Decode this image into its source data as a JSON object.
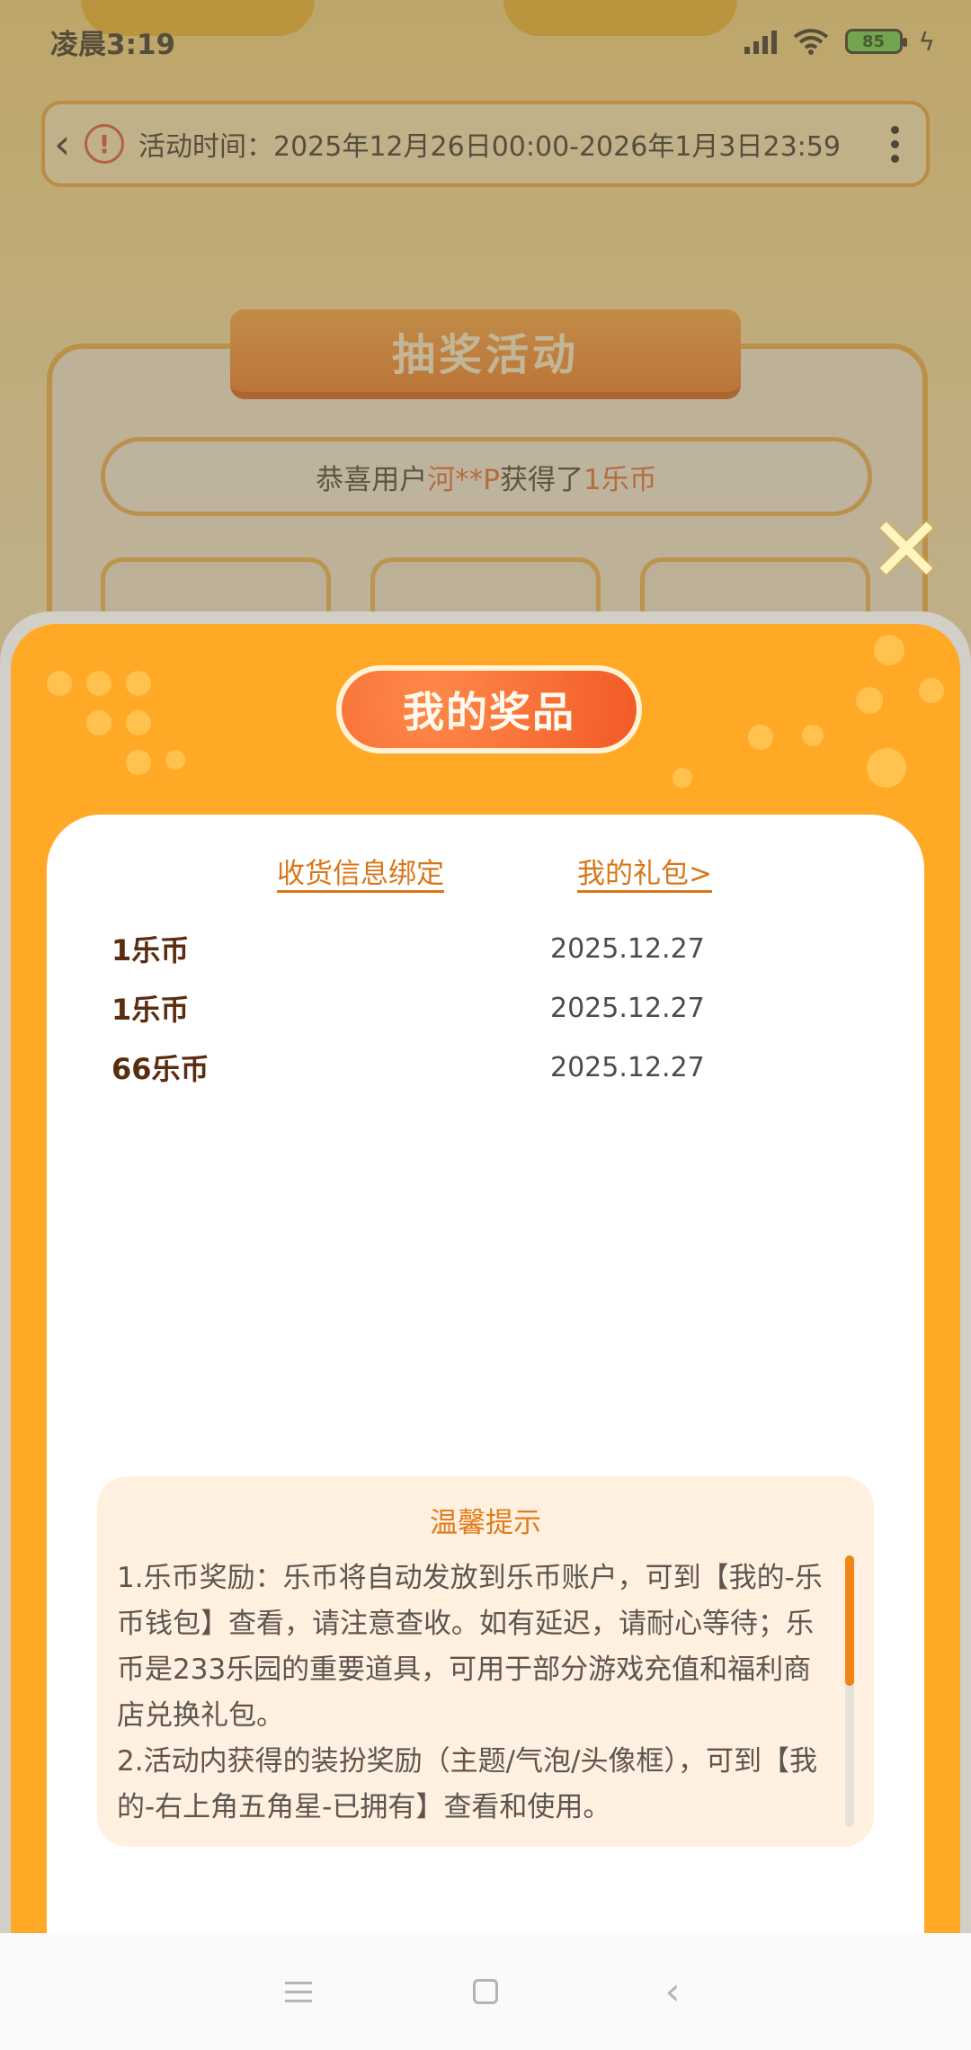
{
  "status_bar": {
    "time": "凌晨3:19",
    "battery": "85"
  },
  "activity": {
    "time_text": "活动时间：2025年12月26日00:00-2026年1月3日23:59"
  },
  "lottery": {
    "title": "抽奖活动",
    "ticker_prefix": "恭喜用户",
    "ticker_user": "河**P",
    "ticker_middle": "获得了",
    "ticker_prize": "1乐币"
  },
  "close_symbol": "✕",
  "prizes_sheet": {
    "title": "我的奖品",
    "link_address": "收货信息绑定",
    "link_gifts": "我的礼包>",
    "items": [
      {
        "name": "1乐币",
        "date": "2025.12.27"
      },
      {
        "name": "1乐币",
        "date": "2025.12.27"
      },
      {
        "name": "66乐币",
        "date": "2025.12.27"
      }
    ],
    "tips_title": "温馨提示",
    "tips_line1": "1.乐币奖励：乐币将自动发放到乐币账户，可到【我的-乐币钱包】查看，请注意查收。如有延迟，请耐心等待；乐币是233乐园的重要道具，可用于部分游戏充值和福利商店兑换礼包。",
    "tips_line2": "2.活动内获得的装扮奖励（主题/气泡/头像框），可到【我的-右上角五角星-已拥有】查看和使用。",
    "tips_scroll_fraction": 0.48
  },
  "colors": {
    "sheet_orange": "#ffa927",
    "link_orange": "#d9761a",
    "prize_brown": "#5a2d10",
    "tips_bg": "#fff0df",
    "tips_accent": "#e07c1a"
  },
  "icons": {
    "back": "back-arrow-icon",
    "alert": "alert-circle-icon",
    "more": "more-vertical-icon",
    "close": "close-icon",
    "nav_menu": "menu-icon",
    "nav_home": "home-square-icon",
    "nav_back": "back-chevron-icon"
  }
}
